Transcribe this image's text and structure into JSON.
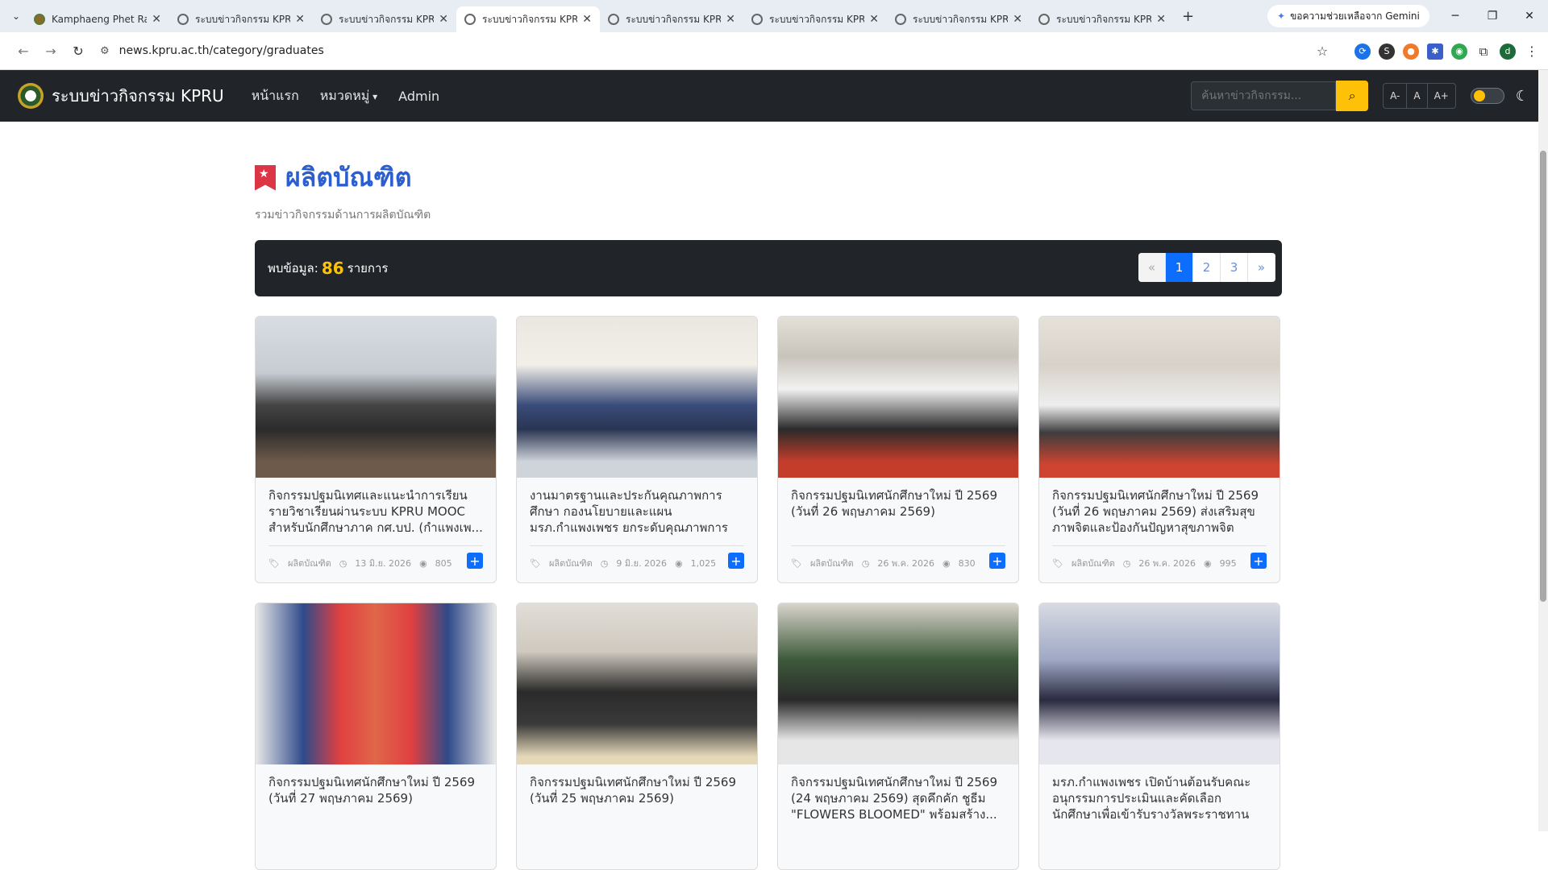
{
  "browser": {
    "tabs": [
      {
        "title": "Kamphaeng Phet Ra",
        "active": false
      },
      {
        "title": "ระบบข่าวกิจกรรม KPRU",
        "active": false
      },
      {
        "title": "ระบบข่าวกิจกรรม KPRU",
        "active": false
      },
      {
        "title": "ระบบข่าวกิจกรรม KPRU",
        "active": true
      },
      {
        "title": "ระบบข่าวกิจกรรม KPRU",
        "active": false
      },
      {
        "title": "ระบบข่าวกิจกรรม KPRU",
        "active": false
      },
      {
        "title": "ระบบข่าวกิจกรรม KPRU",
        "active": false
      },
      {
        "title": "ระบบข่าวกิจกรรม KPRU",
        "active": false
      }
    ],
    "gemini_label": "ขอความช่วยเหลือจาก Gemini",
    "url": "news.kpru.ac.th/category/graduates",
    "profile_initial": "d"
  },
  "navbar": {
    "brand": "ระบบข่าวกิจกรรม KPRU",
    "links": [
      "หน้าแรก",
      "หมวดหมู่",
      "Admin"
    ],
    "search_placeholder": "ค้นหาข่าวกิจกรรม...",
    "font_sizes": [
      "A-",
      "A",
      "A+"
    ]
  },
  "page": {
    "title": "ผลิตบัณฑิต",
    "subtitle": "รวมข่าวกิจกรรมด้านการผลิตบัณฑิต",
    "result_prefix": "พบข้อมูล:",
    "result_count": "86",
    "result_suffix": "รายการ",
    "pagination": [
      "«",
      "1",
      "2",
      "3",
      "»"
    ]
  },
  "cards": [
    {
      "title": "กิจกรรมปฐมนิเทศและแนะนำการเรียน รายวิชาเรียนผ่านระบบ KPRU MOOC สำหรับนักศึกษาภาค กศ.บป. (กำแพงเพ...",
      "category": "ผลิตบัณฑิต",
      "date": "13 มิ.ย. 2026",
      "views": "805"
    },
    {
      "title": "งานมาตรฐานและประกันคุณภาพการศึกษา กองนโยบายและแผน มรภ.กำแพงเพชร ยกระดับคุณภาพการศึกษา จัดอบรมทบทวน...",
      "category": "ผลิตบัณฑิต",
      "date": "9 มิ.ย. 2026",
      "views": "1,025"
    },
    {
      "title": "กิจกรรมปฐมนิเทศนักศึกษาใหม่ ปี 2569 (วันที่ 26 พฤษภาคม 2569)",
      "category": "ผลิตบัณฑิต",
      "date": "26 พ.ค. 2026",
      "views": "830"
    },
    {
      "title": "กิจกรรมปฐมนิเทศนักศึกษาใหม่ ปี 2569 (วันที่ 26 พฤษภาคม 2569) ส่งเสริมสุขภาพจิตและป้องกันปัญหาสุขภาพจิต",
      "category": "ผลิตบัณฑิต",
      "date": "26 พ.ค. 2026",
      "views": "995"
    },
    {
      "title": "กิจกรรมปฐมนิเทศนักศึกษาใหม่ ปี 2569 (วันที่ 27 พฤษภาคม 2569)",
      "category": "",
      "date": "",
      "views": ""
    },
    {
      "title": "กิจกรรมปฐมนิเทศนักศึกษาใหม่ ปี 2569 (วันที่ 25 พฤษภาคม 2569)",
      "category": "",
      "date": "",
      "views": ""
    },
    {
      "title": "กิจกรรมปฐมนิเทศนักศึกษาใหม่ ปี 2569 (24 พฤษภาคม 2569) สุดคึกคัก ชูธีม \"FLOWERS BLOOMED\" พร้อมสร้าง...",
      "category": "",
      "date": "",
      "views": ""
    },
    {
      "title": "มรภ.กำแพงเพชร เปิดบ้านต้อนรับคณะอนุกรรมการประเมินและคัดเลือกนักศึกษาเพื่อเข้ารับรางวัลพระราชทาน ระดับ...",
      "category": "",
      "date": "",
      "views": ""
    }
  ]
}
